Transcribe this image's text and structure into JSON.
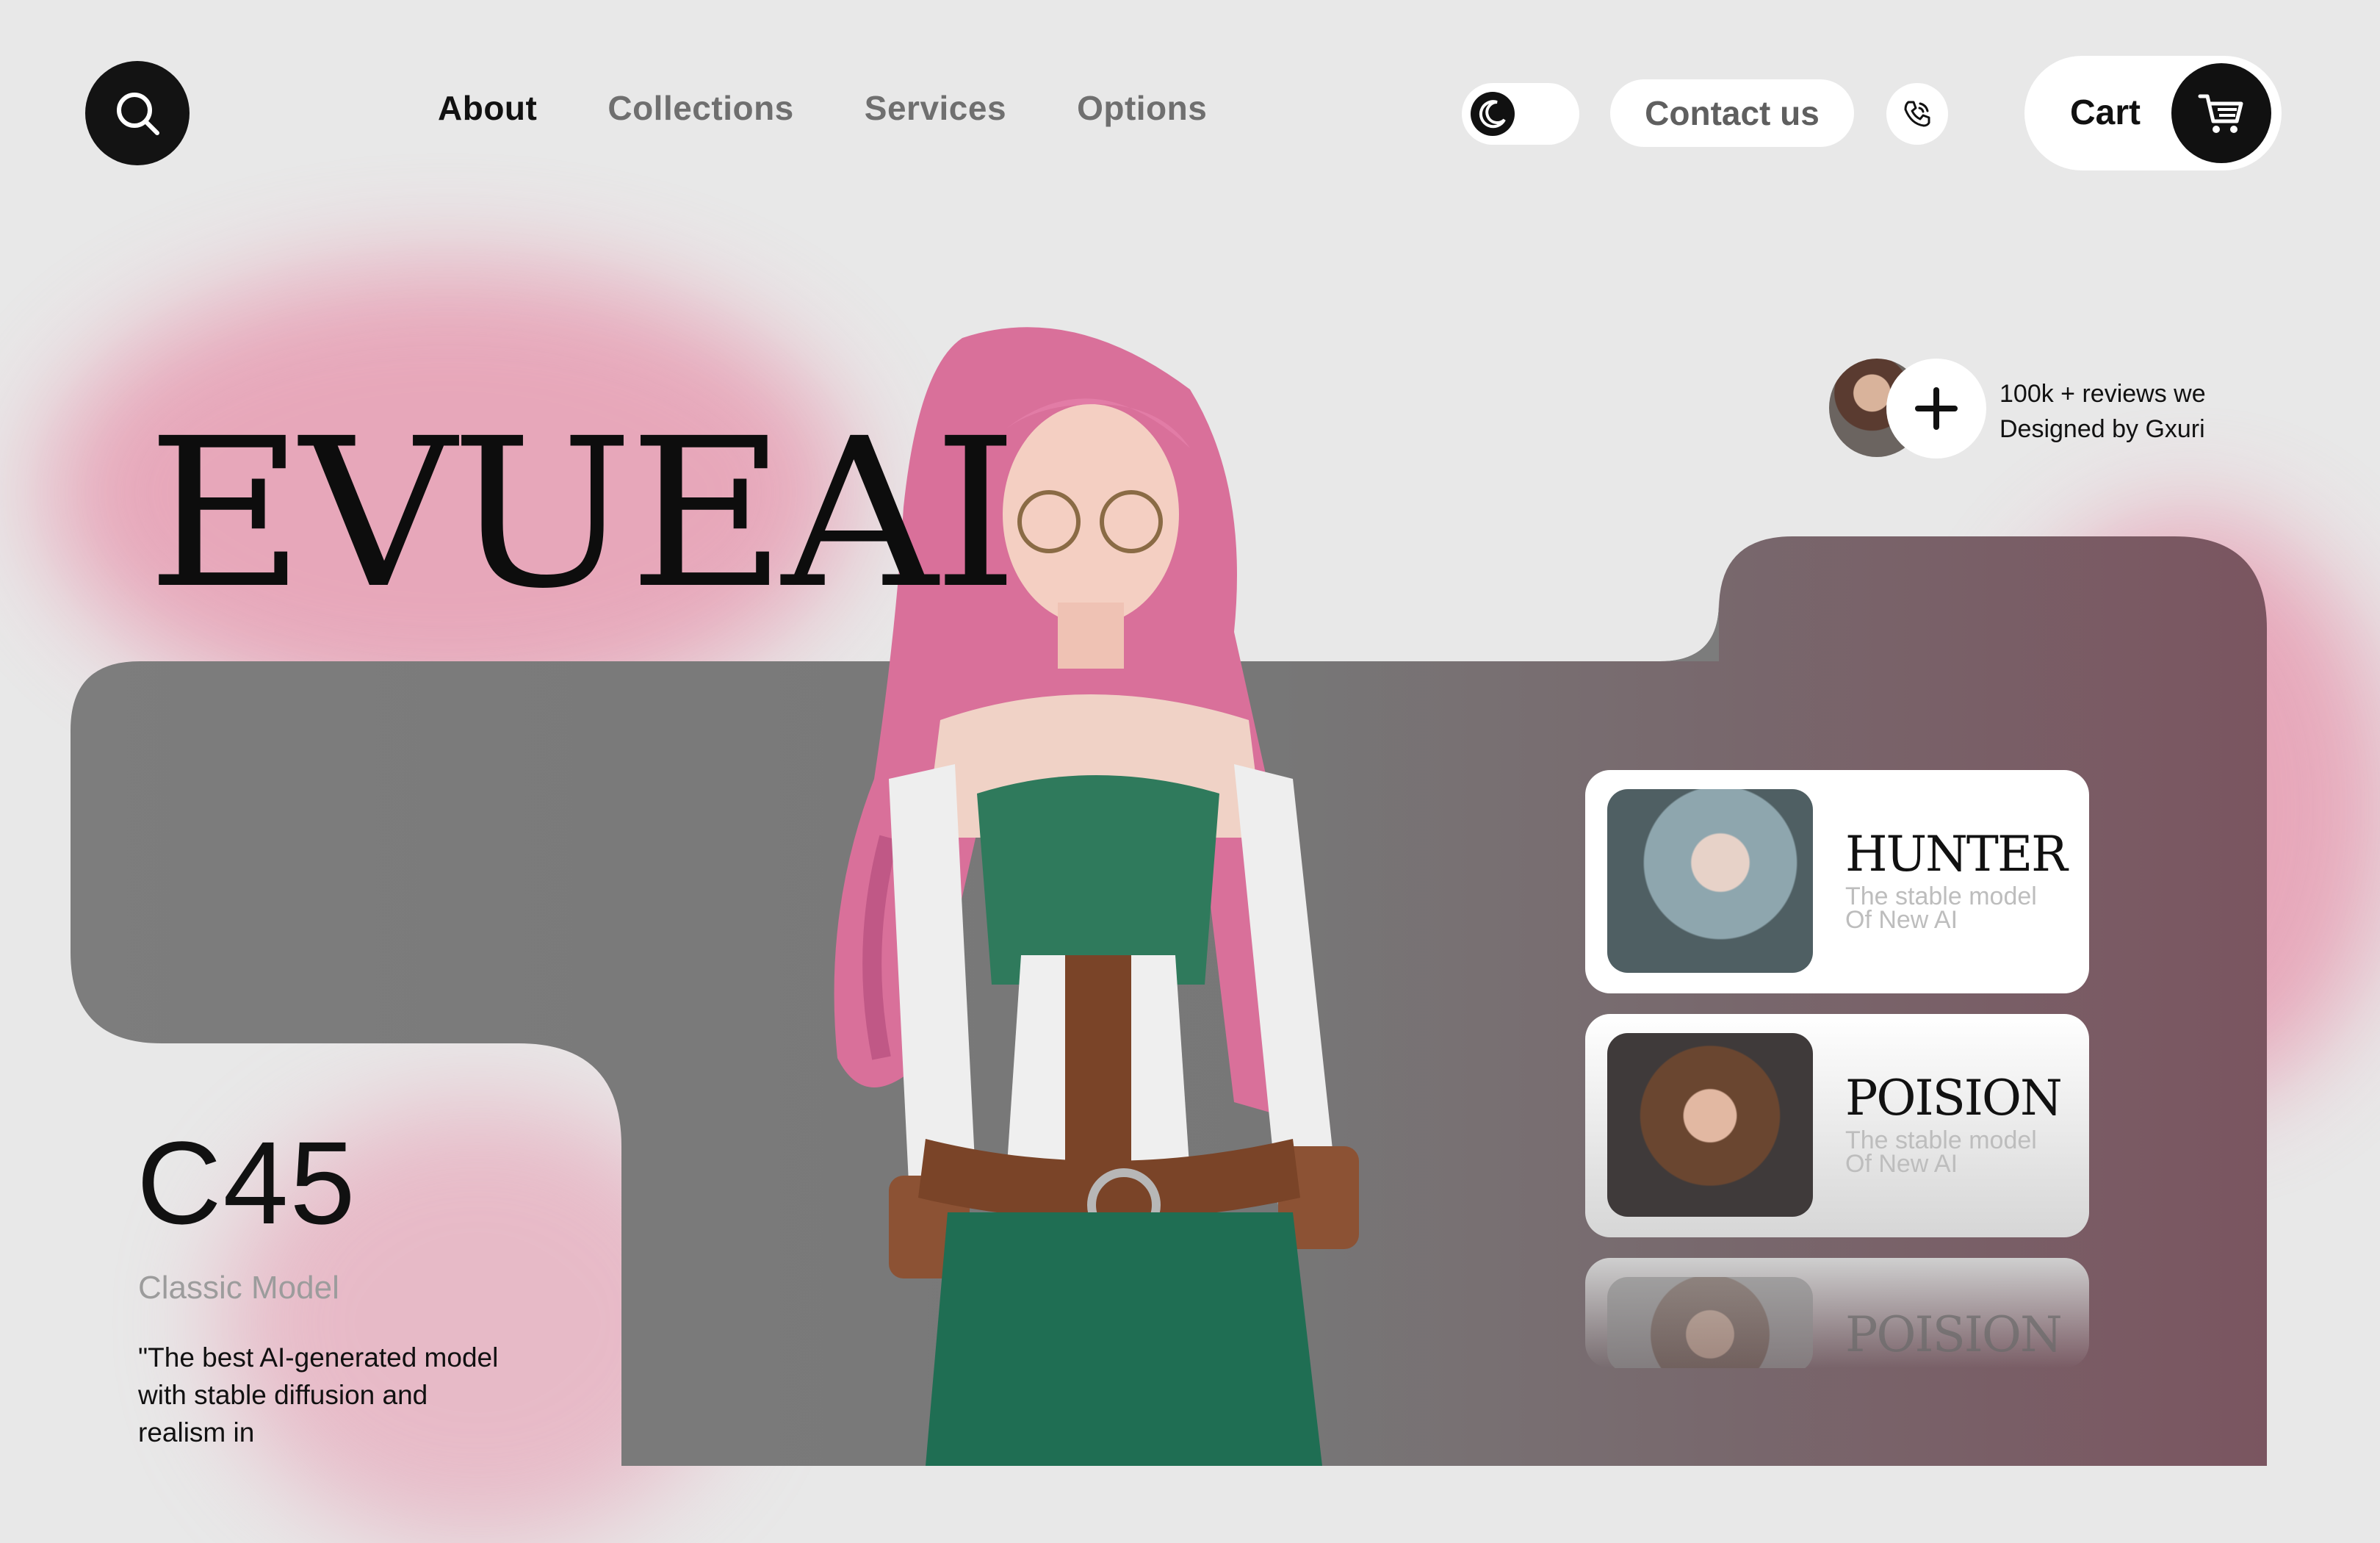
{
  "nav": {
    "items": [
      {
        "label": "About",
        "active": true
      },
      {
        "label": "Collections",
        "active": false
      },
      {
        "label": "Services",
        "active": false
      },
      {
        "label": "Options",
        "active": false
      }
    ]
  },
  "header": {
    "contact_label": "Contact us",
    "cart_label": "Cart",
    "icons": [
      "search-icon",
      "moon-icon",
      "phone-icon",
      "cart-icon"
    ]
  },
  "hero": {
    "logo": "EVUEAI",
    "reviews_line1": "100k + reviews we",
    "reviews_line2": "Designed by Gxuri"
  },
  "cards": [
    {
      "title": "HUNTER",
      "subtitle_line1": "The stable model",
      "subtitle_line2": "Of New AI"
    },
    {
      "title": "POISION",
      "subtitle_line1": "The stable model",
      "subtitle_line2": "Of New AI"
    },
    {
      "title": "POISION"
    }
  ],
  "product": {
    "code": "C45",
    "type": "Classic Model",
    "quote": "\"The best AI-generated model with stable diffusion and realism in"
  },
  "colors": {
    "accent_pink": "#e79cb2",
    "panel_gray": "#7a7a7a",
    "dark": "#111111",
    "background": "#e8e8e8"
  }
}
